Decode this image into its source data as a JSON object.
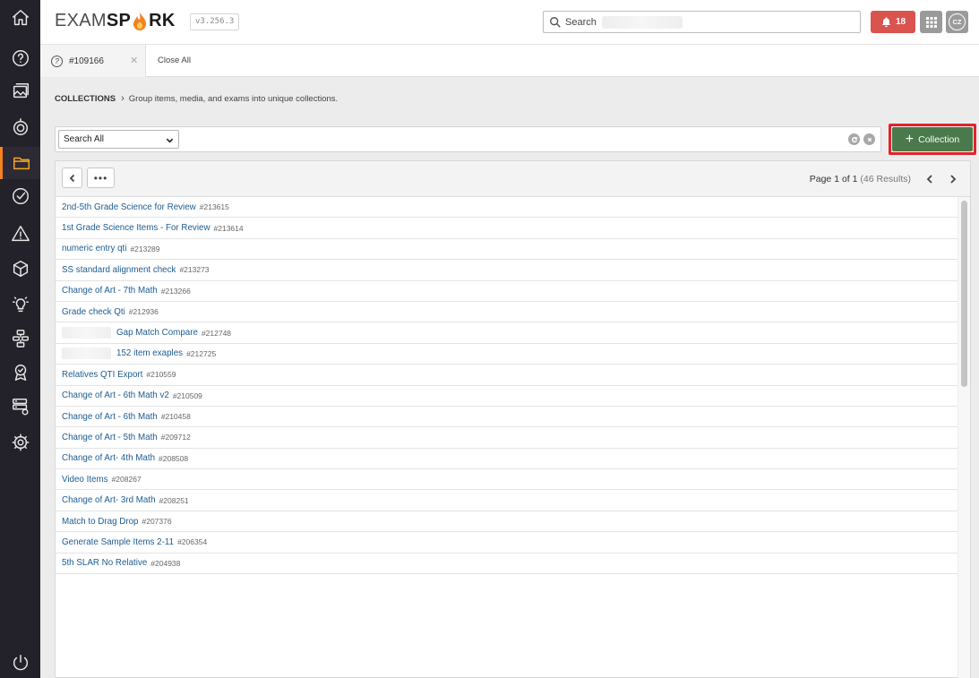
{
  "nav": {
    "items": [
      {
        "name": "home",
        "active": false
      },
      {
        "name": "items",
        "active": false
      },
      {
        "name": "media",
        "active": false
      },
      {
        "name": "exams",
        "active": false
      },
      {
        "name": "collections",
        "active": true
      },
      {
        "name": "reviews",
        "active": false
      },
      {
        "name": "alerts",
        "active": false
      },
      {
        "name": "packages",
        "active": false
      },
      {
        "name": "ideas",
        "active": false
      },
      {
        "name": "workflows",
        "active": false
      },
      {
        "name": "badges",
        "active": false
      },
      {
        "name": "servers",
        "active": false
      },
      {
        "name": "settings",
        "active": false
      }
    ],
    "power_icon": "power-icon"
  },
  "header": {
    "logo_part1": "EXAM",
    "logo_part2": "SP",
    "logo_part3": "RK",
    "version": "v3.256.3",
    "search_placeholder": "Search",
    "notifications_count": "18",
    "avatar_initials": "CZ"
  },
  "tabs": {
    "items": [
      {
        "label": "#109166"
      }
    ],
    "close_all": "Close All"
  },
  "breadcrumb": {
    "section": "COLLECTIONS",
    "description": "Group items, media, and exams into unique collections."
  },
  "search": {
    "scope": "Search All"
  },
  "toolbar": {
    "add_collection": "Collection"
  },
  "pagination": {
    "page_text": "Page 1 of 1",
    "results_text": "(46 Results)"
  },
  "collections": [
    {
      "name": "2nd-5th Grade Science for Review",
      "id": "#213615",
      "redacted": false
    },
    {
      "name": "1st Grade Science Items - For Review",
      "id": "#213614",
      "redacted": false
    },
    {
      "name": "numeric entry qti",
      "id": "#213289",
      "redacted": false
    },
    {
      "name": "SS standard alignment check",
      "id": "#213273",
      "redacted": false
    },
    {
      "name": "Change of Art - 7th Math",
      "id": "#213266",
      "redacted": false
    },
    {
      "name": "Grade check Qti",
      "id": "#212936",
      "redacted": false
    },
    {
      "name": "Gap Match Compare",
      "id": "#212748",
      "redacted": true
    },
    {
      "name": "152 item exaples",
      "id": "#212725",
      "redacted": true
    },
    {
      "name": "Relatives QTI Export",
      "id": "#210559",
      "redacted": false
    },
    {
      "name": "Change of Art - 6th Math v2",
      "id": "#210509",
      "redacted": false
    },
    {
      "name": "Change of Art - 6th Math",
      "id": "#210458",
      "redacted": false
    },
    {
      "name": "Change of Art - 5th Math",
      "id": "#209712",
      "redacted": false
    },
    {
      "name": "Change of Art- 4th Math",
      "id": "#208508",
      "redacted": false
    },
    {
      "name": "Video Items",
      "id": "#208267",
      "redacted": false
    },
    {
      "name": "Change of Art- 3rd Math",
      "id": "#208251",
      "redacted": false
    },
    {
      "name": "Match to Drag Drop",
      "id": "#207376",
      "redacted": false
    },
    {
      "name": "Generate Sample Items 2-11",
      "id": "#206354",
      "redacted": false
    },
    {
      "name": "5th SLAR No Relative",
      "id": "#204938",
      "redacted": false
    }
  ],
  "colors": {
    "nav_bg": "#232129",
    "accent": "#f58220",
    "link": "#1d5c93",
    "notification": "#d9534f",
    "add_button": "#4a7a4c",
    "highlight_border": "#e3222a"
  }
}
